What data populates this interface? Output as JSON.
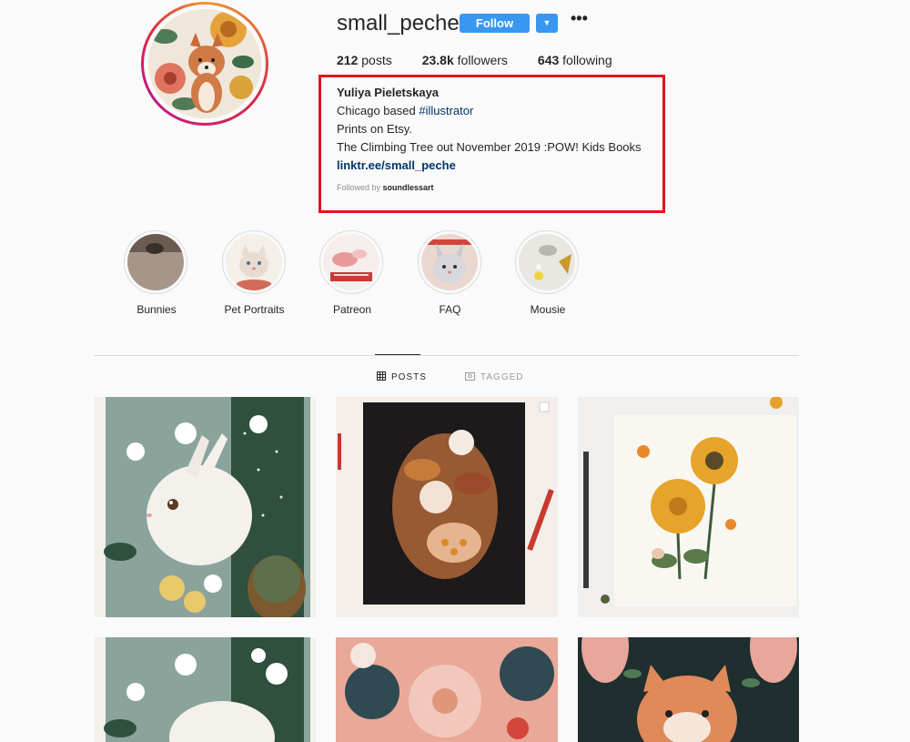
{
  "profile": {
    "username": "small_peche",
    "follow_label": "Follow",
    "dropdown_icon": "chevron-down-icon",
    "more_icon": "more-options-icon",
    "more_glyph": "•••",
    "stats": {
      "posts_count": "212",
      "posts_label": "posts",
      "followers_count": "23.8k",
      "followers_label": "followers",
      "following_count": "643",
      "following_label": "following"
    },
    "bio": {
      "full_name": "Yuliya Pieletskaya",
      "line1_prefix": "Chicago based ",
      "line1_hashtag": "#illustrator",
      "line2": "Prints on Etsy.",
      "line3": "The Climbing Tree out November 2019 :POW! Kids Books",
      "link": "linktr.ee/small_peche",
      "followed_by_prefix": "Followed by ",
      "followed_by_user": "soundlessart"
    },
    "highlight_box_color": "#e0141e"
  },
  "highlights": [
    {
      "label": "Bunnies"
    },
    {
      "label": "Pet Portraits"
    },
    {
      "label": "Patreon"
    },
    {
      "label": "FAQ"
    },
    {
      "label": "Mousie"
    }
  ],
  "tabs": {
    "posts": "POSTS",
    "tagged": "TAGGED"
  },
  "colors": {
    "accent": "#3897f0",
    "link": "#003569",
    "muted": "#8e8e8e"
  }
}
